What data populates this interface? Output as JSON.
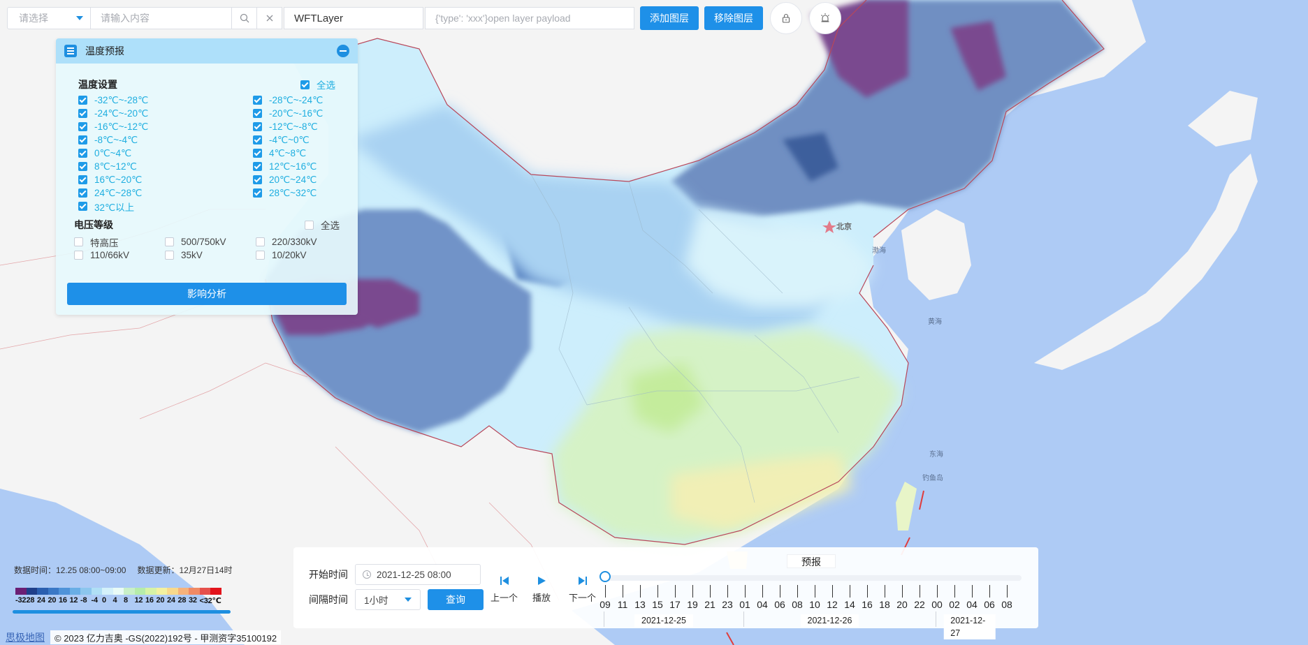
{
  "toolbar": {
    "select_placeholder": "请选择",
    "search_placeholder": "请输入内容",
    "layer_name": "WFTLayer",
    "payload_placeholder": "{'type': 'xxx'}open layer payload",
    "add_layer": "添加图层",
    "remove_layer": "移除图层"
  },
  "panel": {
    "title": "温度预报",
    "temp_section": {
      "title": "温度设置",
      "select_all": "全选",
      "select_all_checked": true,
      "items": [
        {
          "label": "-32℃~-28℃",
          "checked": true
        },
        {
          "label": "-28℃~-24℃",
          "checked": true
        },
        {
          "label": "-24℃~-20℃",
          "checked": true
        },
        {
          "label": "-20℃~-16℃",
          "checked": true
        },
        {
          "label": "-16℃~-12℃",
          "checked": true
        },
        {
          "label": "-12℃~-8℃",
          "checked": true
        },
        {
          "label": "-8℃~-4℃",
          "checked": true
        },
        {
          "label": "-4℃~0℃",
          "checked": true
        },
        {
          "label": "0℃~4℃",
          "checked": true
        },
        {
          "label": "4℃~8℃",
          "checked": true
        },
        {
          "label": "8℃~12℃",
          "checked": true
        },
        {
          "label": "12℃~16℃",
          "checked": true
        },
        {
          "label": "16℃~20℃",
          "checked": true
        },
        {
          "label": "20℃~24℃",
          "checked": true
        },
        {
          "label": "24℃~28℃",
          "checked": true
        },
        {
          "label": "28℃~32℃",
          "checked": true
        },
        {
          "label": "32℃以上",
          "checked": true
        }
      ]
    },
    "volt_section": {
      "title": "电压等级",
      "select_all": "全选",
      "select_all_checked": false,
      "items": [
        {
          "label": "特高压",
          "checked": false
        },
        {
          "label": "500/750kV",
          "checked": false
        },
        {
          "label": "220/330kV",
          "checked": false
        },
        {
          "label": "110/66kV",
          "checked": false
        },
        {
          "label": "35kV",
          "checked": false
        },
        {
          "label": "10/20kV",
          "checked": false
        }
      ]
    },
    "analyze_button": "影响分析"
  },
  "map": {
    "labels": {
      "beijing": "北京",
      "bohai": "渤海",
      "yellow_sea": "黄海",
      "east_china_sea": "东海",
      "diaoyu": "钓鱼岛"
    }
  },
  "legend": {
    "data_time": "数据时间：12.25 08:00~09:00",
    "data_update": "数据更新：12月27日14时",
    "colors": [
      "#6b1f74",
      "#1f3f8a",
      "#2a5fb0",
      "#3a78c6",
      "#4f93d9",
      "#69aee6",
      "#8cc6ee",
      "#b0dff5",
      "#d4f1fa",
      "#e9fbf6",
      "#c9f0c8",
      "#b6ecaa",
      "#d7f3a6",
      "#f3f1a0",
      "#f8d98c",
      "#f6b27a",
      "#f08a64",
      "#e6504b",
      "#e3141b"
    ],
    "labels": [
      "-32",
      "28",
      "24",
      "20",
      "16",
      "12",
      "-8",
      "-4",
      "0",
      "4",
      "8",
      "12",
      "16",
      "20",
      "24",
      "28",
      "32",
      "<32℃"
    ]
  },
  "footer": {
    "logo": "思极地图",
    "copyright": "© 2023 亿力吉奥 -GS(2022)192号 - 甲测资字35100192"
  },
  "timebar": {
    "start_label": "开始时间",
    "start_value": "2021-12-25 08:00",
    "interval_label": "间隔时间",
    "interval_value": "1小时",
    "query": "查询",
    "prev": "上一个",
    "play": "播放",
    "next": "下一个",
    "forecast_label": "预报",
    "ticks": [
      "09",
      "11",
      "13",
      "15",
      "17",
      "19",
      "21",
      "23",
      "01",
      "04",
      "06",
      "08",
      "10",
      "12",
      "14",
      "16",
      "18",
      "20",
      "22",
      "00",
      "02",
      "04",
      "06",
      "08"
    ],
    "dates": [
      "2021-12-25",
      "2021-12-26",
      "2021-12-27"
    ],
    "progress": 0
  },
  "colors": {
    "accent": "#1e90e8",
    "checked_text": "#1eaee0"
  }
}
